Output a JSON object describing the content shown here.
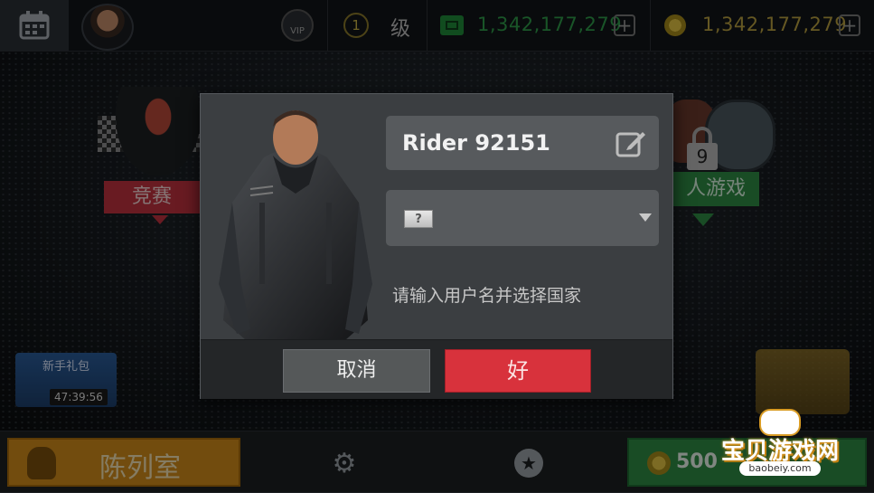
{
  "topbar": {
    "level_number": "1",
    "level_suffix": "级",
    "vip_label": "VIP",
    "green_currency": "1,342,177,279",
    "gold_currency": "1,342,177,279",
    "plus_symbol": "+"
  },
  "modes": {
    "race_label": "竞赛",
    "multiplayer_label": "人游戏",
    "lock_level": "9"
  },
  "gift": {
    "title": "新手礼包",
    "timer": "47:39:56"
  },
  "dialog": {
    "name_value": "Rider 92151",
    "country_flag": "?",
    "hint": "请输入用户名并选择国家",
    "cancel_label": "取消",
    "ok_label": "好"
  },
  "bottombar": {
    "garage_label": "陈列室",
    "buy_amount": "500",
    "star_glyph": "★",
    "gear_glyph": "⚙"
  },
  "watermark": {
    "brand": "宝贝游戏网",
    "url": "baobeiy.com"
  },
  "colors": {
    "ok": "#d8323c",
    "race": "#c0323e",
    "multiplayer": "#2e8a44",
    "garage": "#d08a1a"
  }
}
